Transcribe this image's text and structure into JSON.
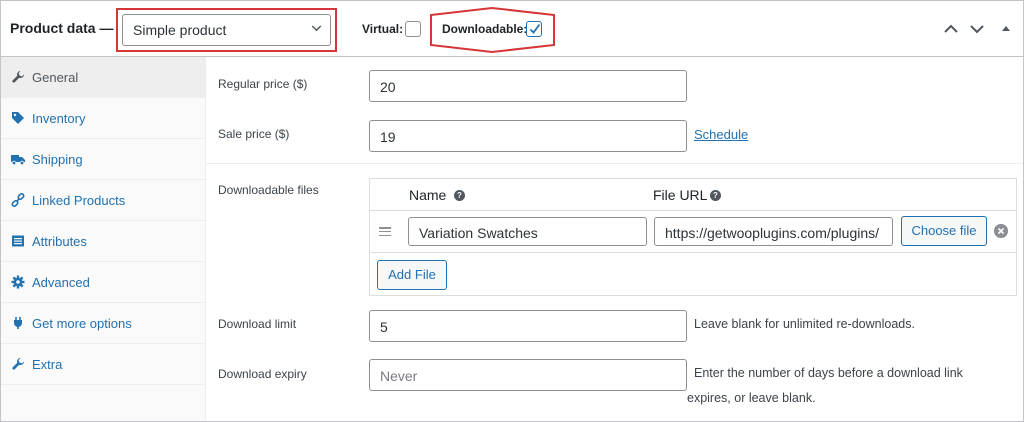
{
  "header": {
    "title": "Product data —",
    "product_type": "Simple product",
    "virtual_label": "Virtual:",
    "virtual_checked": false,
    "downloadable_label": "Downloadable:",
    "downloadable_checked": true,
    "highlight_color": "#d63638"
  },
  "sidebar": {
    "items": [
      {
        "label": "General",
        "icon": "wrench-icon",
        "active": true
      },
      {
        "label": "Inventory",
        "icon": "tag-icon",
        "active": false
      },
      {
        "label": "Shipping",
        "icon": "truck-icon",
        "active": false
      },
      {
        "label": "Linked Products",
        "icon": "link-icon",
        "active": false
      },
      {
        "label": "Attributes",
        "icon": "list-icon",
        "active": false
      },
      {
        "label": "Advanced",
        "icon": "gear-icon",
        "active": false
      },
      {
        "label": "Get more options",
        "icon": "plugin-icon",
        "active": false
      },
      {
        "label": "Extra",
        "icon": "wrench-icon",
        "active": false
      }
    ]
  },
  "general": {
    "regular_price_label": "Regular price ($)",
    "regular_price_value": "20",
    "sale_price_label": "Sale price ($)",
    "sale_price_value": "19",
    "schedule_link": "Schedule",
    "downloadable_files_label": "Downloadable files",
    "files": {
      "name_header": "Name",
      "url_header": "File URL",
      "rows": [
        {
          "name": "Variation Swatches",
          "url": "https://getwooplugins.com/plugins/"
        }
      ],
      "choose_file_label": "Choose file",
      "add_file_label": "Add File"
    },
    "download_limit_label": "Download limit",
    "download_limit_value": "5",
    "download_limit_desc": "Leave blank for unlimited re-downloads.",
    "download_expiry_label": "Download expiry",
    "download_expiry_placeholder": "Never",
    "download_expiry_desc_line1": "Enter the number of days before a download link",
    "download_expiry_desc_line2": "expires, or leave blank."
  }
}
